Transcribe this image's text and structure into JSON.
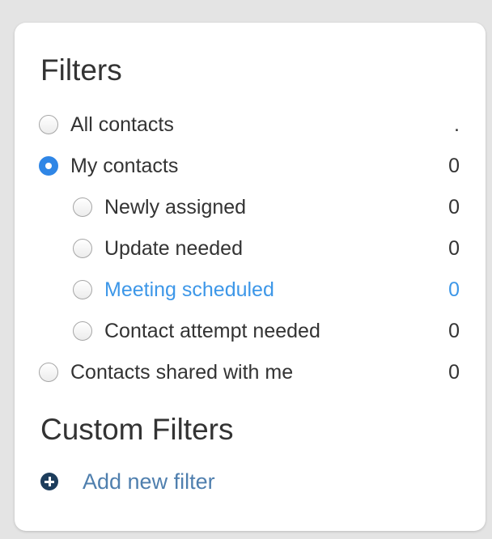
{
  "filters": {
    "title": "Filters",
    "items": [
      {
        "label": "All contacts",
        "count": ".",
        "checked": false,
        "indent": false,
        "highlight": false
      },
      {
        "label": "My contacts",
        "count": "0",
        "checked": true,
        "indent": false,
        "highlight": false
      },
      {
        "label": "Newly assigned",
        "count": "0",
        "checked": false,
        "indent": true,
        "highlight": false
      },
      {
        "label": "Update needed",
        "count": "0",
        "checked": false,
        "indent": true,
        "highlight": false
      },
      {
        "label": "Meeting scheduled",
        "count": "0",
        "checked": false,
        "indent": true,
        "highlight": true
      },
      {
        "label": "Contact attempt needed",
        "count": "0",
        "checked": false,
        "indent": true,
        "highlight": false
      },
      {
        "label": "Contacts shared with me",
        "count": "0",
        "checked": false,
        "indent": false,
        "highlight": false
      }
    ]
  },
  "custom_filters": {
    "title": "Custom Filters",
    "add_label": "Add new filter",
    "add_icon": "plus-circle-icon"
  },
  "colors": {
    "accent": "#2f86e6",
    "highlight_text": "#3d97e8",
    "link_text": "#4f7fae",
    "add_icon_bg": "#1d3d5c"
  }
}
